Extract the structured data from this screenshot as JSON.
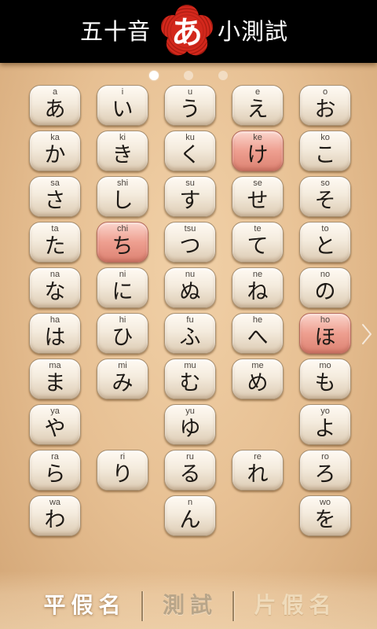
{
  "header": {
    "title_left": "五十音",
    "logo_char": "あ",
    "title_right": "小測試"
  },
  "pagination": {
    "pages": 3,
    "active_index": 0
  },
  "kana_grid": {
    "rows": [
      [
        {
          "romaji": "a",
          "kana": "あ"
        },
        {
          "romaji": "i",
          "kana": "い"
        },
        {
          "romaji": "u",
          "kana": "う"
        },
        {
          "romaji": "e",
          "kana": "え"
        },
        {
          "romaji": "o",
          "kana": "お"
        }
      ],
      [
        {
          "romaji": "ka",
          "kana": "か"
        },
        {
          "romaji": "ki",
          "kana": "き"
        },
        {
          "romaji": "ku",
          "kana": "く"
        },
        {
          "romaji": "ke",
          "kana": "け",
          "highlighted": true
        },
        {
          "romaji": "ko",
          "kana": "こ"
        }
      ],
      [
        {
          "romaji": "sa",
          "kana": "さ"
        },
        {
          "romaji": "shi",
          "kana": "し"
        },
        {
          "romaji": "su",
          "kana": "す"
        },
        {
          "romaji": "se",
          "kana": "せ"
        },
        {
          "romaji": "so",
          "kana": "そ"
        }
      ],
      [
        {
          "romaji": "ta",
          "kana": "た"
        },
        {
          "romaji": "chi",
          "kana": "ち",
          "highlighted": true
        },
        {
          "romaji": "tsu",
          "kana": "つ"
        },
        {
          "romaji": "te",
          "kana": "て"
        },
        {
          "romaji": "to",
          "kana": "と"
        }
      ],
      [
        {
          "romaji": "na",
          "kana": "な"
        },
        {
          "romaji": "ni",
          "kana": "に"
        },
        {
          "romaji": "nu",
          "kana": "ぬ"
        },
        {
          "romaji": "ne",
          "kana": "ね"
        },
        {
          "romaji": "no",
          "kana": "の"
        }
      ],
      [
        {
          "romaji": "ha",
          "kana": "は"
        },
        {
          "romaji": "hi",
          "kana": "ひ"
        },
        {
          "romaji": "fu",
          "kana": "ふ"
        },
        {
          "romaji": "he",
          "kana": "へ"
        },
        {
          "romaji": "ho",
          "kana": "ほ",
          "highlighted": true
        }
      ],
      [
        {
          "romaji": "ma",
          "kana": "ま"
        },
        {
          "romaji": "mi",
          "kana": "み"
        },
        {
          "romaji": "mu",
          "kana": "む"
        },
        {
          "romaji": "me",
          "kana": "め"
        },
        {
          "romaji": "mo",
          "kana": "も"
        }
      ],
      [
        {
          "romaji": "ya",
          "kana": "や"
        },
        null,
        {
          "romaji": "yu",
          "kana": "ゆ"
        },
        null,
        {
          "romaji": "yo",
          "kana": "よ"
        }
      ],
      [
        {
          "romaji": "ra",
          "kana": "ら"
        },
        {
          "romaji": "ri",
          "kana": "り"
        },
        {
          "romaji": "ru",
          "kana": "る"
        },
        {
          "romaji": "re",
          "kana": "れ"
        },
        {
          "romaji": "ro",
          "kana": "ろ"
        }
      ],
      [
        {
          "romaji": "wa",
          "kana": "わ"
        },
        null,
        {
          "romaji": "n",
          "kana": "ん"
        },
        null,
        {
          "romaji": "wo",
          "kana": "を"
        }
      ]
    ]
  },
  "tabs": [
    {
      "label": "平假名",
      "active": true
    },
    {
      "label": "測試",
      "active": false
    },
    {
      "label": "片假名",
      "active": false
    }
  ],
  "icons": {
    "logo": "plum-blossom-logo-icon",
    "next_page": "chevron-right-icon"
  },
  "colors": {
    "header_bg": "#000000",
    "logo_red": "#d3281c",
    "key_face": "#f4ebdd",
    "key_highlight": "#ee9f90",
    "tab_active": "#ffffff",
    "tab_inactive": "#b8a589",
    "tab_dim": "#efdbbb"
  }
}
